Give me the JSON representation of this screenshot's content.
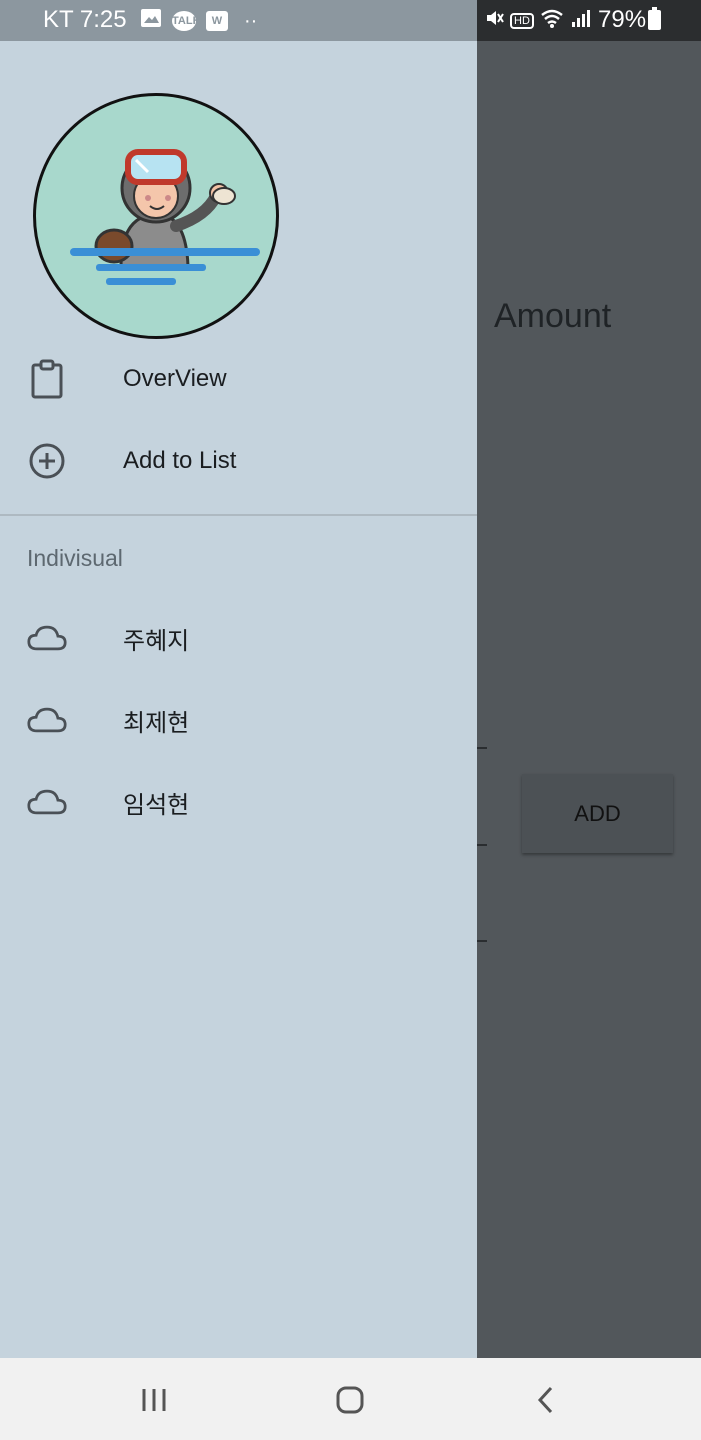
{
  "status_bar": {
    "carrier_time": "KT 7:25",
    "icons": [
      "image-icon",
      "talk-icon",
      "w-icon"
    ],
    "talk_badge": "TALK",
    "w_badge": "W",
    "dots": "··",
    "right_icons": [
      "mute-icon",
      "hd-icon",
      "wifi-icon",
      "signal-icon"
    ],
    "hd_label": "HD",
    "battery": "79%"
  },
  "drawer": {
    "menu": [
      {
        "label": "OverView",
        "icon": "clipboard-icon"
      },
      {
        "label": "Add to List",
        "icon": "add-circle-icon"
      }
    ],
    "section_title": "Indivisual",
    "people": [
      {
        "label": "주혜지",
        "icon": "cloud-icon"
      },
      {
        "label": "최제현",
        "icon": "cloud-icon"
      },
      {
        "label": "임석현",
        "icon": "cloud-icon"
      }
    ]
  },
  "background": {
    "amount_label": "Amount",
    "add_button": "ADD"
  },
  "nav": {
    "recents": "recents-icon",
    "home": "home-icon",
    "back": "back-icon"
  },
  "colors": {
    "drawer_bg": "#c5d3dd",
    "scrim": "#52575b",
    "status_left": "#8c979f",
    "status_right": "#2b2d2f",
    "avatar_bg": "#a8d8cc"
  }
}
